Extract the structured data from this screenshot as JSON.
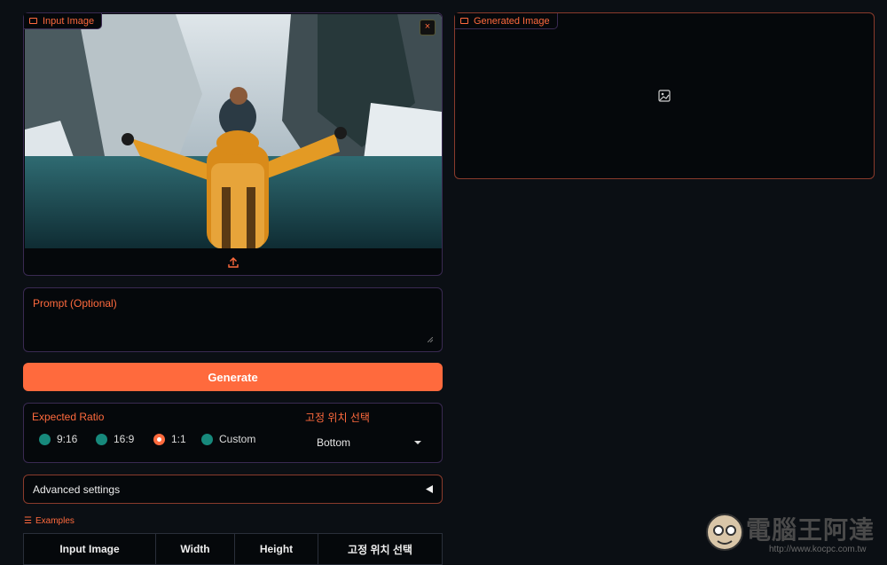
{
  "input_panel": {
    "tag": "Input Image",
    "close": "×"
  },
  "output_panel": {
    "tag": "Generated Image"
  },
  "prompt": {
    "label": "Prompt (Optional)"
  },
  "generate": {
    "label": "Generate"
  },
  "ratio": {
    "label": "Expected Ratio",
    "options": [
      "9:16",
      "16:9",
      "1:1",
      "Custom"
    ],
    "selected": "1:1"
  },
  "position": {
    "label": "고정 위치 선택",
    "value": "Bottom"
  },
  "advanced": {
    "label": "Advanced settings"
  },
  "examples": {
    "label": "Examples",
    "headers": [
      "Input Image",
      "Width",
      "Height",
      "고정 위치 선택"
    ]
  },
  "watermark": {
    "title": "電腦王阿達",
    "url": "http://www.kocpc.com.tw"
  },
  "colors": {
    "accent": "#ff6a3d",
    "radio": "#17897c",
    "background": "#0b0f14"
  }
}
